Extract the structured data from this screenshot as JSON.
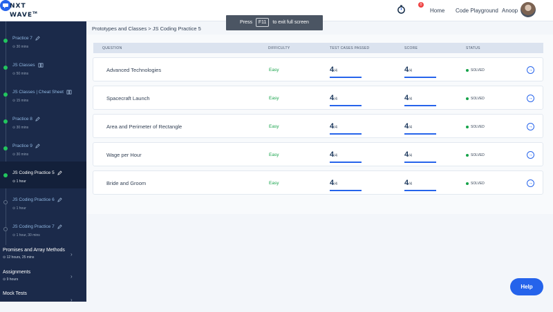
{
  "header": {
    "logo_line1": "NXT",
    "logo_line2": "WAVE",
    "logo_mark": "TM",
    "timer_icon": "timer-icon",
    "chat_icon": "chat-icon",
    "chat_badge": "0",
    "nav_home": "Home",
    "nav_code": "Code Playground",
    "user_name": "Anoop"
  },
  "toast": {
    "before": "Press",
    "key": "F11",
    "after": "to exit full screen"
  },
  "sidebar": {
    "items": [
      {
        "title": "Practice 7",
        "sub": "30 mins",
        "icon": "pencil-icon",
        "done": true
      },
      {
        "title": "JS Classes",
        "sub": "50 mins",
        "icon": "book-icon",
        "done": true
      },
      {
        "title": "JS Classes | Cheat Sheet",
        "sub": "15 mins",
        "icon": "book-icon",
        "done": true
      },
      {
        "title": "Practice 8",
        "sub": "30 mins",
        "icon": "pencil-icon",
        "done": true
      },
      {
        "title": "Practice 9",
        "sub": "30 mins",
        "icon": "pencil-icon",
        "done": true
      },
      {
        "title": "JS Coding Practice 5",
        "sub": "1 hour",
        "icon": "pencil-icon",
        "done": true
      },
      {
        "title": "JS Coding Practice 6",
        "sub": "1 hour",
        "icon": "pencil-icon",
        "done": false
      },
      {
        "title": "JS Coding Practice 7",
        "sub": "1 hour, 30 mins",
        "icon": "pencil-icon",
        "done": false
      }
    ],
    "modules": [
      {
        "title": "Promises and Array Methods",
        "sub": "12 hours, 25 mins"
      },
      {
        "title": "Assignments",
        "sub": "9 hours"
      },
      {
        "title": "Mock Tests",
        "sub": ""
      }
    ]
  },
  "breadcrumb": "Prototypes and Classes > JS Coding Practice 5",
  "table": {
    "headers": {
      "question": "QUESTION",
      "difficulty": "DIFFICULTY",
      "tests": "TEST CASES PASSED",
      "score": "SCORE",
      "status": "STATUS"
    },
    "rows": [
      {
        "name": "Advanced Technologies",
        "difficulty": "Easy",
        "tests": "4",
        "tests_total": "/4",
        "tests_pct": 1.0,
        "score": "4",
        "score_total": "/4",
        "score_pct": 1.0,
        "status": "SOLVED"
      },
      {
        "name": "Spacecraft Launch",
        "difficulty": "Easy",
        "tests": "4",
        "tests_total": "/4",
        "tests_pct": 1.0,
        "score": "4",
        "score_total": "/4",
        "score_pct": 1.0,
        "status": "SOLVED"
      },
      {
        "name": "Area and Perimeter of Rectangle",
        "difficulty": "Easy",
        "tests": "4",
        "tests_total": "/4",
        "tests_pct": 1.0,
        "score": "4",
        "score_total": "/4",
        "score_pct": 1.0,
        "status": "SOLVED"
      },
      {
        "name": "Wage per Hour",
        "difficulty": "Easy",
        "tests": "4",
        "tests_total": "/4",
        "tests_pct": 1.0,
        "score": "4",
        "score_total": "/4",
        "score_pct": 1.0,
        "status": "SOLVED"
      },
      {
        "name": "Bride and Groom",
        "difficulty": "Easy",
        "tests": "4",
        "tests_total": "/4",
        "tests_pct": 1.0,
        "score": "4",
        "score_total": "/4",
        "score_pct": 1.0,
        "status": "SOLVED"
      }
    ]
  },
  "help_label": "Help",
  "colors": {
    "accent": "#2563eb",
    "success": "#16a34a",
    "sidebar": "#1b2a4a"
  }
}
